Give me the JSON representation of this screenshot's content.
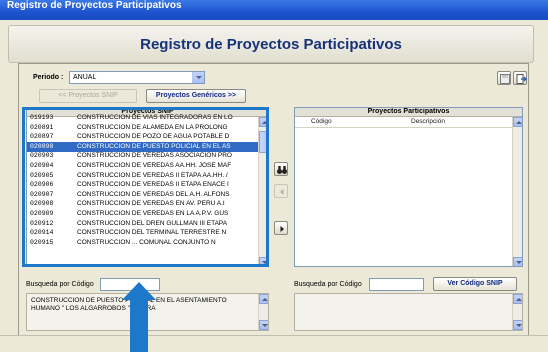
{
  "window": {
    "title": "Registro de Proyectos Participativos"
  },
  "header": {
    "title": "Registro de Proyectos Participativos"
  },
  "period": {
    "label": "Periodo :",
    "value": "ANUAL"
  },
  "buttons": {
    "proyectos_snip": "<< Proyectos SNIP",
    "proyectos_genericos": "Proyectos Genéricos >>",
    "ver_codigo_snip": "Ver Código SNIP"
  },
  "left_list": {
    "title": "Proyectos SNIP",
    "rows": [
      {
        "code": "019193",
        "desc": "CONSTRUCCION DE VIAS INTEGRADORAS EN LO"
      },
      {
        "code": "020891",
        "desc": "CONSTRUCCION DE ALAMEDA EN LA PROLONG"
      },
      {
        "code": "020897",
        "desc": "CONSTRUCCION DE POZO DE AGUA POTABLE D"
      },
      {
        "code": "020898",
        "desc": "CONSTRUCCION DE PUESTO POLICIAL EN EL AS"
      },
      {
        "code": "020903",
        "desc": "CONSTRUCCION DE VEREDAS ASOCIACION PRO"
      },
      {
        "code": "020904",
        "desc": "CONSTRUCCION DE VEREDAS AA.HH. JOSE MAF"
      },
      {
        "code": "020905",
        "desc": "CONSTRUCCION DE VEREDAS II ETAPA AA.HH. /"
      },
      {
        "code": "020906",
        "desc": "CONSTRUCCION DE VEREDAS II ETAPA ENACE I"
      },
      {
        "code": "020907",
        "desc": "CONSTRUCCION DE VEREDAS DEL A.H. ALFONS"
      },
      {
        "code": "020908",
        "desc": "CONSTRUCCION DE VEREDAS EN AV. PERU A.I"
      },
      {
        "code": "020909",
        "desc": "CONSTRUCCION DE VEREDAS EN LA A.P.V. GUS"
      },
      {
        "code": "020912",
        "desc": "CONSTRUCCION DEL DREN GULLMAN III ETAPA"
      },
      {
        "code": "020914",
        "desc": "CONSTRUCCION DEL TERMINAL TERRESTRE N"
      },
      {
        "code": "020915",
        "desc": "CONSTRUCCION ... COMUNAL CONJUNTO N"
      }
    ],
    "selected_index": 3,
    "search_label": "Busqueda por Código",
    "memo": "CONSTRUCCION DE PUESTO POLICIAL EN EL ASENTAMIENTO HUMANO \" LOS ALGARROBOS \" - PIURA"
  },
  "right_list": {
    "title": "Proyectos Participativos",
    "col_code": "Código",
    "col_desc": "Descripción",
    "search_label": "Busqueda por Código"
  },
  "icons": {
    "binoculars": "binoculars-icon",
    "move_left": "arrow-left-icon",
    "move_right": "arrow-right-icon",
    "save": "save-icon",
    "exit": "exit-icon"
  },
  "colors": {
    "highlight": "#1d78c9",
    "header_title": "#16327a",
    "selection": "#316ac5"
  }
}
